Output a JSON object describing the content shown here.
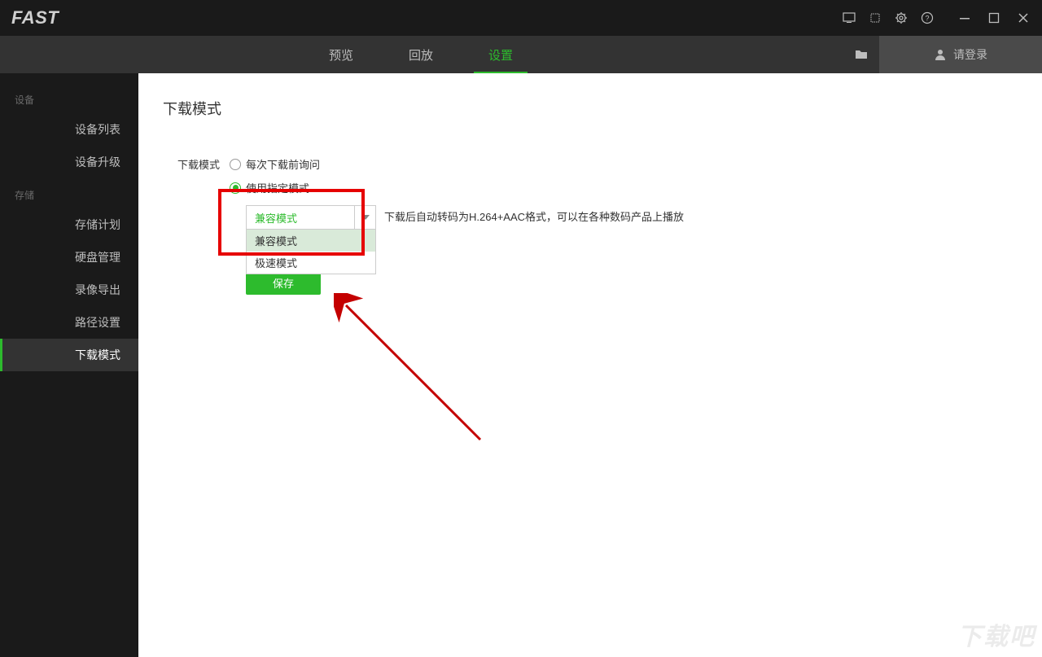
{
  "app": {
    "logo": "FAST"
  },
  "nav": {
    "tabs": [
      {
        "label": "预览"
      },
      {
        "label": "回放"
      },
      {
        "label": "设置"
      }
    ],
    "login": "请登录"
  },
  "sidebar": {
    "group1": {
      "title": "设备",
      "items": [
        "设备列表",
        "设备升级"
      ]
    },
    "group2": {
      "title": "存储",
      "items": [
        "存储计划",
        "硬盘管理",
        "录像导出",
        "路径设置",
        "下载模式"
      ]
    }
  },
  "page": {
    "title": "下载模式",
    "form_label": "下载模式",
    "radio1": "每次下载前询问",
    "radio2": "使用指定模式",
    "select_value": "兼容模式",
    "options": [
      "兼容模式",
      "极速模式"
    ],
    "hint": "下载后自动转码为H.264+AAC格式，可以在各种数码产品上播放",
    "save": "保存"
  },
  "watermark": "下载吧"
}
